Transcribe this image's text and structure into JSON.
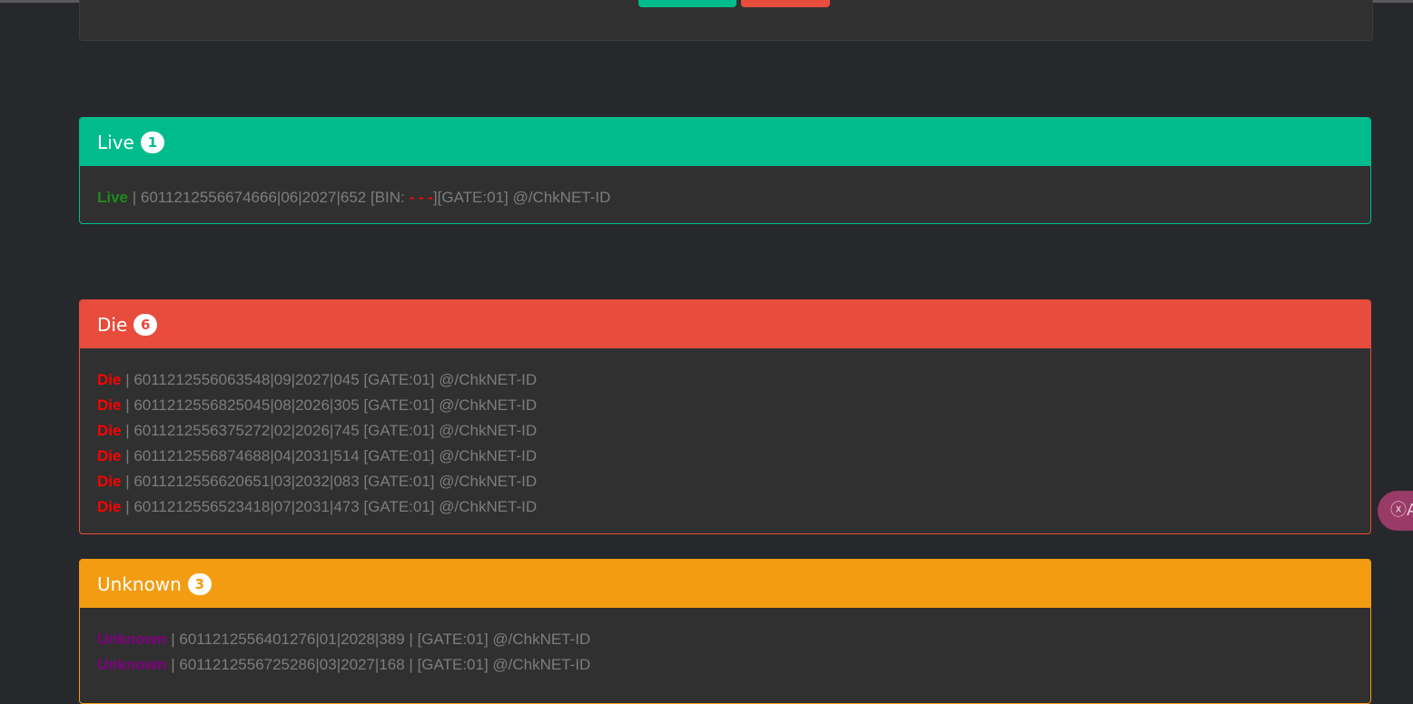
{
  "live": {
    "title": "Live",
    "count": "1",
    "lines": [
      {
        "status": "Live",
        "text": " | 6011212556674666|06|2027|652 [BIN: ",
        "bin": "- - -",
        "suffix": "][GATE:01] @/ChkNET-ID"
      }
    ]
  },
  "die": {
    "title": "Die",
    "count": "6",
    "lines": [
      {
        "status": "Die",
        "text": " | 6011212556063548|09|2027|045 [GATE:01] @/ChkNET-ID"
      },
      {
        "status": "Die",
        "text": " | 6011212556825045|08|2026|305 [GATE:01] @/ChkNET-ID"
      },
      {
        "status": "Die",
        "text": " | 6011212556375272|02|2026|745 [GATE:01] @/ChkNET-ID"
      },
      {
        "status": "Die",
        "text": " | 6011212556874688|04|2031|514 [GATE:01] @/ChkNET-ID"
      },
      {
        "status": "Die",
        "text": " | 6011212556620651|03|2032|083 [GATE:01] @/ChkNET-ID"
      },
      {
        "status": "Die",
        "text": " | 6011212556523418|07|2031|473 [GATE:01] @/ChkNET-ID"
      }
    ]
  },
  "unknown": {
    "title": "Unknown",
    "count": "3",
    "lines": [
      {
        "status": "Unknown",
        "text": " | 6011212556401276|01|2028|389 | [GATE:01] @/ChkNET-ID"
      },
      {
        "status": "Unknown",
        "text": " | 6011212556725286|03|2027|168 | [GATE:01] @/ChkNET-ID"
      }
    ]
  },
  "translate_widget": {
    "label": "ⓧA",
    "icon": "translate-icon"
  },
  "colors": {
    "background": "#27282c",
    "live": "#00bc8c",
    "die": "#e74c3c",
    "unknown": "#f39c12",
    "text_muted": "#7d7d7d"
  }
}
